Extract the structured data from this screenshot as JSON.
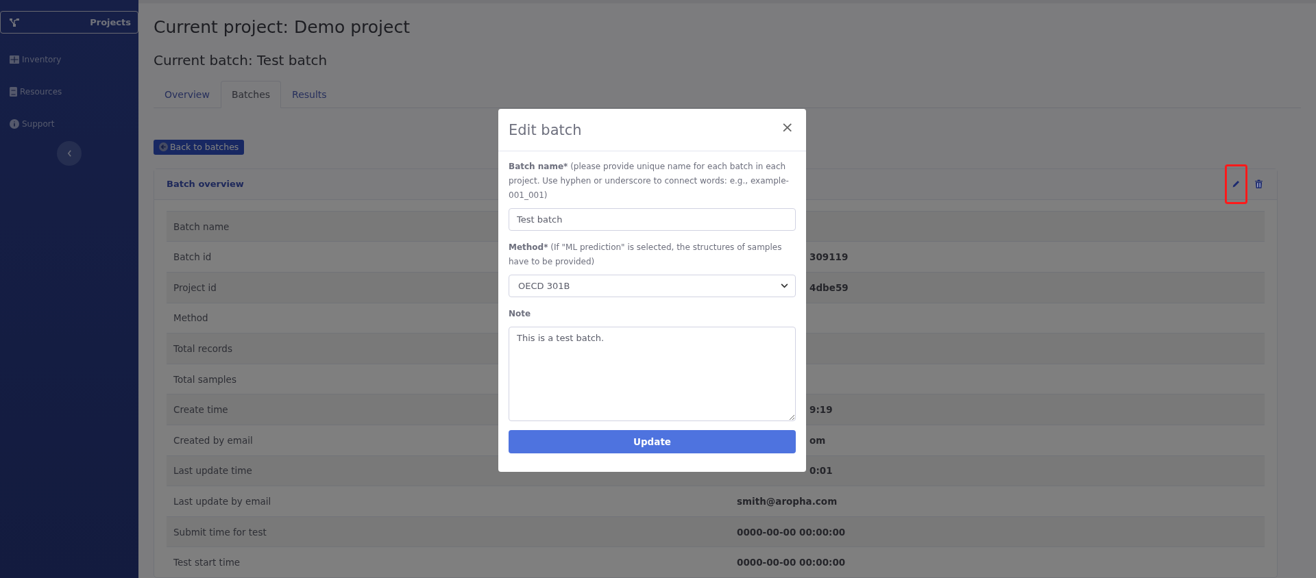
{
  "sidebar": {
    "items": [
      {
        "label": "Projects",
        "selected": true
      },
      {
        "label": "Inventory",
        "selected": false
      },
      {
        "label": "Resources",
        "selected": false
      },
      {
        "label": "Support",
        "selected": false
      }
    ]
  },
  "page": {
    "project_title": "Current project: Demo project",
    "batch_title": "Current batch: Test batch"
  },
  "tabs": [
    {
      "label": "Overview",
      "selected": false
    },
    {
      "label": "Batches",
      "selected": true
    },
    {
      "label": "Results",
      "selected": false
    }
  ],
  "back_button": "Back to batches",
  "card": {
    "title": "Batch overview",
    "actions": [
      {
        "kind": "edit",
        "highlighted": true
      },
      {
        "kind": "delete",
        "highlighted": false
      }
    ],
    "rows": [
      {
        "label": "Batch name"
      },
      {
        "label": "Batch id",
        "value_tail": "309119"
      },
      {
        "label": "Project id",
        "value_tail": "4dbe59"
      },
      {
        "label": "Method"
      },
      {
        "label": "Total records"
      },
      {
        "label": "Total samples"
      },
      {
        "label": "Create time",
        "value_tail": "9:19"
      },
      {
        "label": "Created by email",
        "value_tail": "om"
      },
      {
        "label": "Last update time",
        "value_tail": "0:01"
      },
      {
        "label": "Last update by email",
        "value": "smith@aropha.com"
      },
      {
        "label": "Submit time for test",
        "value": "0000-00-00 00:00:00"
      },
      {
        "label": "Test start time",
        "value": "0000-00-00 00:00:00"
      }
    ]
  },
  "dialog": {
    "title": "Edit batch",
    "close": "×",
    "fields": [
      {
        "kind": "text",
        "label": "Batch name*",
        "hint": "(please provide unique name for each batch in each project. Use hyphen or underscore to connect words: e.g., example-001_001)",
        "value": "Test batch"
      },
      {
        "kind": "select",
        "label": "Method*",
        "hint": "(If \"ML prediction\" is selected, the structures of samples have to be provided)",
        "value": "OECD 301B"
      },
      {
        "kind": "textarea",
        "label": "Note",
        "value": "This is a test batch."
      }
    ],
    "submit": "Update"
  }
}
